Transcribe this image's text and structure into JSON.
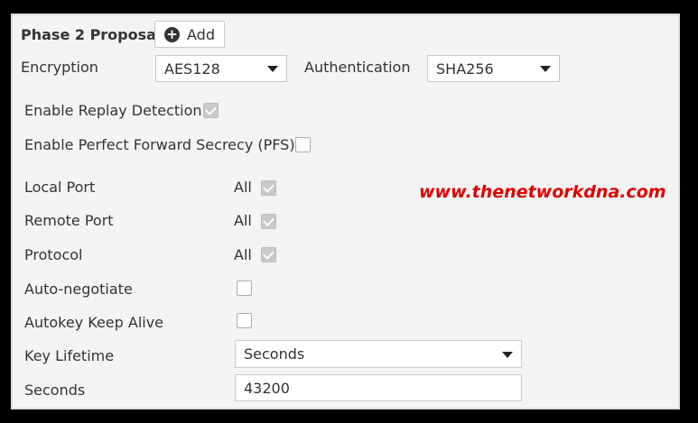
{
  "header": {
    "title": "Phase 2 Proposal",
    "add_label": "Add"
  },
  "encryption": {
    "label": "Encryption",
    "value": "AES128"
  },
  "authentication": {
    "label": "Authentication",
    "value": "SHA256"
  },
  "replay_detection": {
    "label": "Enable Replay Detection",
    "checked": true
  },
  "pfs": {
    "label": "Enable Perfect Forward Secrecy (PFS)",
    "checked": false
  },
  "local_port": {
    "label": "Local Port",
    "value": "All",
    "checked": true
  },
  "remote_port": {
    "label": "Remote Port",
    "value": "All",
    "checked": true
  },
  "protocol": {
    "label": "Protocol",
    "value": "All",
    "checked": true
  },
  "auto_negotiate": {
    "label": "Auto-negotiate",
    "checked": false
  },
  "autokey_keep_alive": {
    "label": "Autokey Keep Alive",
    "checked": false
  },
  "key_lifetime": {
    "label": "Key Lifetime",
    "value": "Seconds"
  },
  "seconds": {
    "label": "Seconds",
    "value": "43200"
  },
  "watermark": "www.thenetworkdna.com",
  "colors": {
    "watermark": "#e00000",
    "panel_bg": "#f4f4f4",
    "frame": "#000000"
  }
}
